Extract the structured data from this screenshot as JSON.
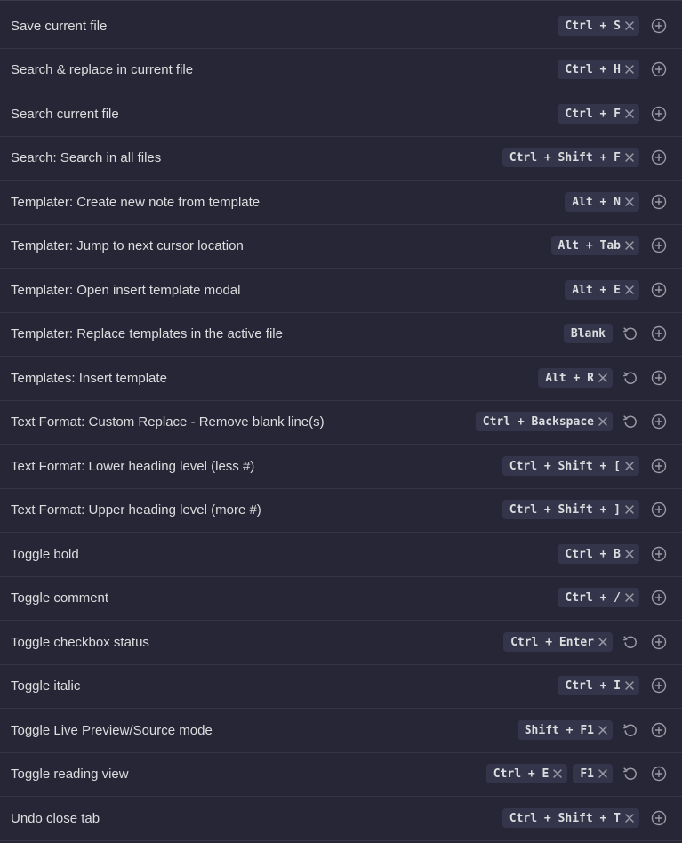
{
  "colors": {
    "background": "#262636",
    "row_divider": "#363646",
    "hotkey_bg": "#34354a",
    "text": "#dcddde",
    "icon": "#9a9aa6"
  },
  "icons": {
    "remove": "close-icon",
    "restore": "reset-icon",
    "add": "plus-circle-icon"
  },
  "commands": [
    {
      "name": "Save current file",
      "hotkeys": [
        "Ctrl + S"
      ],
      "restore": false
    },
    {
      "name": "Search & replace in current file",
      "hotkeys": [
        "Ctrl + H"
      ],
      "restore": false
    },
    {
      "name": "Search current file",
      "hotkeys": [
        "Ctrl + F"
      ],
      "restore": false
    },
    {
      "name": "Search: Search in all files",
      "hotkeys": [
        "Ctrl + Shift + F"
      ],
      "restore": false
    },
    {
      "name": "Templater: Create new note from template",
      "hotkeys": [
        "Alt + N"
      ],
      "restore": false
    },
    {
      "name": "Templater: Jump to next cursor location",
      "hotkeys": [
        "Alt + Tab"
      ],
      "restore": false
    },
    {
      "name": "Templater: Open insert template modal",
      "hotkeys": [
        "Alt + E"
      ],
      "restore": false
    },
    {
      "name": "Templater: Replace templates in the active file",
      "hotkeys": [],
      "blank_label": "Blank",
      "restore": true
    },
    {
      "name": "Templates: Insert template",
      "hotkeys": [
        "Alt + R"
      ],
      "restore": true
    },
    {
      "name": "Text Format: Custom Replace - Remove blank line(s)",
      "hotkeys": [
        "Ctrl + Backspace"
      ],
      "restore": true
    },
    {
      "name": "Text Format: Lower heading level (less #)",
      "hotkeys": [
        "Ctrl + Shift + ["
      ],
      "restore": false
    },
    {
      "name": "Text Format: Upper heading level (more #)",
      "hotkeys": [
        "Ctrl + Shift + ]"
      ],
      "restore": false
    },
    {
      "name": "Toggle bold",
      "hotkeys": [
        "Ctrl + B"
      ],
      "restore": false
    },
    {
      "name": "Toggle comment",
      "hotkeys": [
        "Ctrl + /"
      ],
      "restore": false
    },
    {
      "name": "Toggle checkbox status",
      "hotkeys": [
        "Ctrl + Enter"
      ],
      "restore": true
    },
    {
      "name": "Toggle italic",
      "hotkeys": [
        "Ctrl + I"
      ],
      "restore": false
    },
    {
      "name": "Toggle Live Preview/Source mode",
      "hotkeys": [
        "Shift + F1"
      ],
      "restore": true
    },
    {
      "name": "Toggle reading view",
      "hotkeys": [
        "Ctrl + E",
        "F1"
      ],
      "restore": true
    },
    {
      "name": "Undo close tab",
      "hotkeys": [
        "Ctrl + Shift + T"
      ],
      "restore": false
    }
  ]
}
